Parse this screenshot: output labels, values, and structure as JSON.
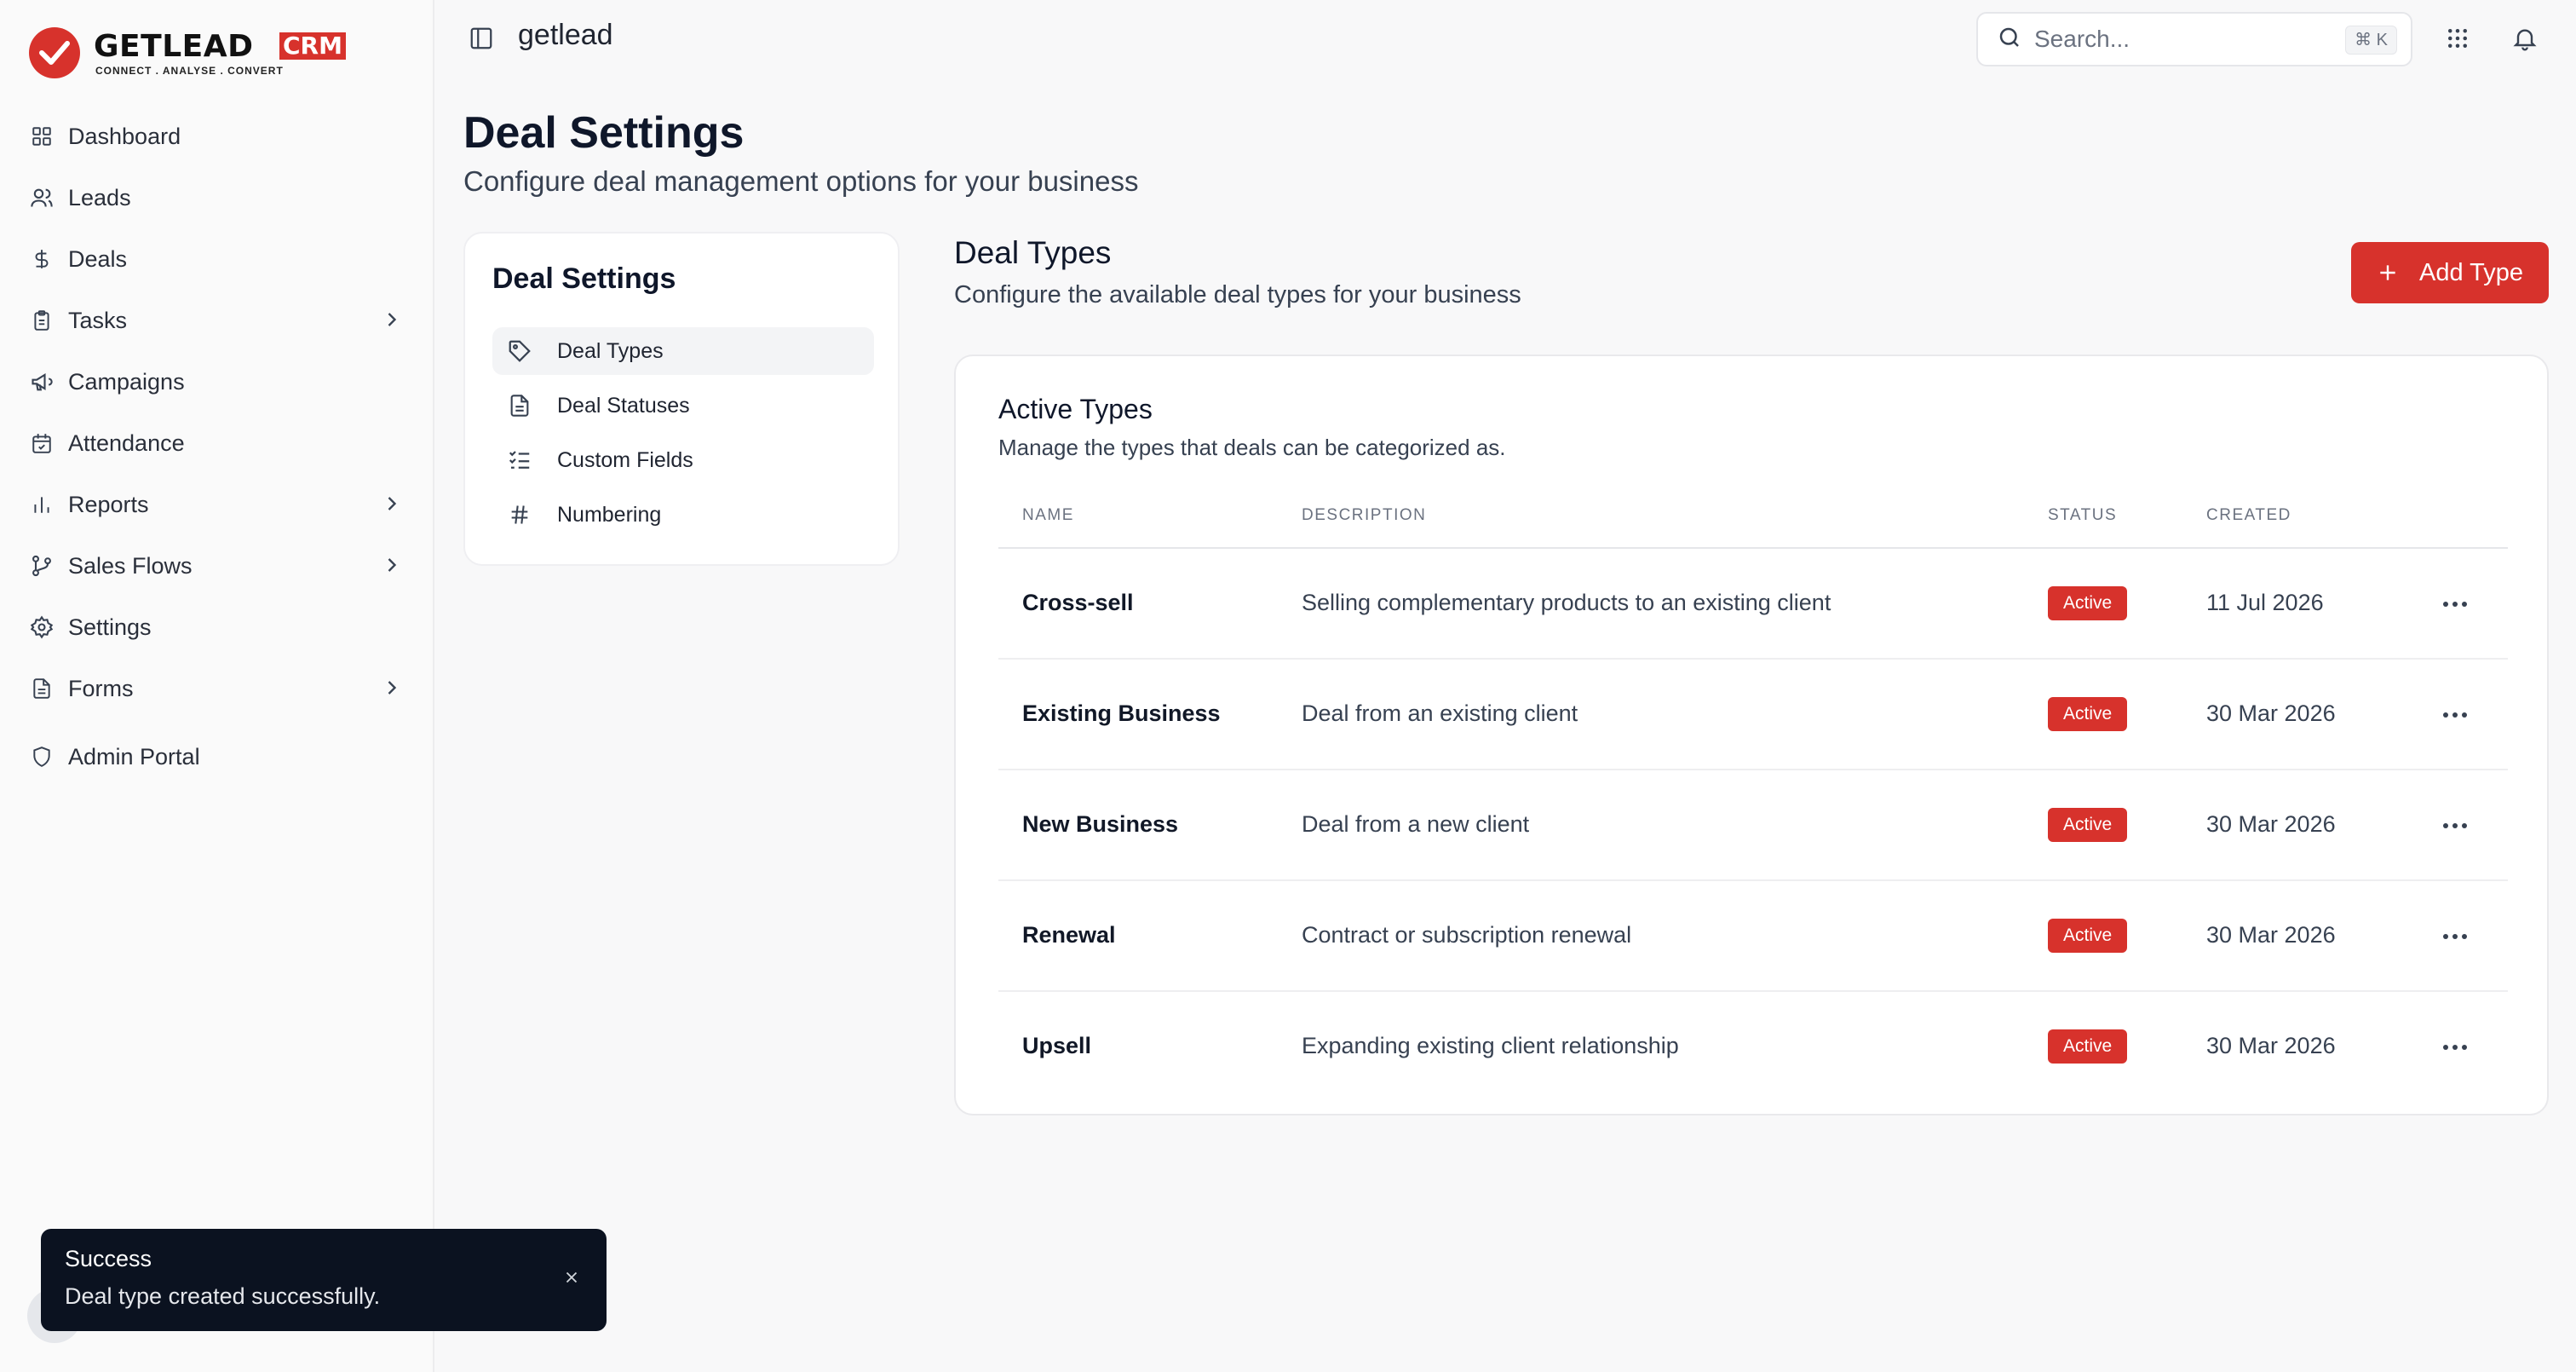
{
  "app": {
    "workspace_name": "getlead",
    "logo_text": "GETLEAD",
    "logo_badge": "CRM",
    "logo_tagline": "CONNECT . ANALYSE . CONVERT"
  },
  "sidebar": {
    "items": [
      {
        "label": "Dashboard",
        "icon": "grid-icon"
      },
      {
        "label": "Leads",
        "icon": "users-icon"
      },
      {
        "label": "Deals",
        "icon": "dollar-icon"
      },
      {
        "label": "Tasks",
        "icon": "clipboard-icon",
        "has_children": true
      },
      {
        "label": "Campaigns",
        "icon": "megaphone-icon"
      },
      {
        "label": "Attendance",
        "icon": "calendar-check-icon"
      },
      {
        "label": "Reports",
        "icon": "bar-chart-icon",
        "has_children": true
      },
      {
        "label": "Sales Flows",
        "icon": "git-branch-icon",
        "has_children": true
      },
      {
        "label": "Settings",
        "icon": "gear-icon"
      },
      {
        "label": "Forms",
        "icon": "file-icon",
        "has_children": true
      },
      {
        "label": "Admin Portal",
        "icon": "shield-icon"
      }
    ]
  },
  "topbar": {
    "search_placeholder": "Search...",
    "search_shortcut": "⌘ K"
  },
  "page": {
    "title": "Deal Settings",
    "subtitle": "Configure deal management options for your business"
  },
  "settings_nav": {
    "title": "Deal Settings",
    "items": [
      {
        "label": "Deal Types",
        "icon": "tag-icon",
        "active": true
      },
      {
        "label": "Deal Statuses",
        "icon": "document-icon",
        "active": false
      },
      {
        "label": "Custom Fields",
        "icon": "checklist-icon",
        "active": false
      },
      {
        "label": "Numbering",
        "icon": "hash-icon",
        "active": false
      }
    ]
  },
  "section": {
    "title": "Deal Types",
    "subtitle": "Configure the available deal types for your business",
    "add_button": "Add Type"
  },
  "table": {
    "title": "Active Types",
    "subtitle": "Manage the types that deals can be categorized as.",
    "columns": [
      "NAME",
      "DESCRIPTION",
      "STATUS",
      "CREATED"
    ],
    "rows": [
      {
        "name": "Cross-sell",
        "description": "Selling complementary products to an existing client",
        "status": "Active",
        "created": "11 Jul 2026"
      },
      {
        "name": "Existing Business",
        "description": "Deal from an existing client",
        "status": "Active",
        "created": "30 Mar 2026"
      },
      {
        "name": "New Business",
        "description": "Deal from a new client",
        "status": "Active",
        "created": "30 Mar 2026"
      },
      {
        "name": "Renewal",
        "description": "Contract or subscription renewal",
        "status": "Active",
        "created": "30 Mar 2026"
      },
      {
        "name": "Upsell",
        "description": "Expanding existing client relationship",
        "status": "Active",
        "created": "30 Mar 2026"
      }
    ]
  },
  "toast": {
    "title": "Success",
    "message": "Deal type created successfully."
  },
  "colors": {
    "brand": "#d7322c",
    "toast_bg": "#0b1220"
  }
}
